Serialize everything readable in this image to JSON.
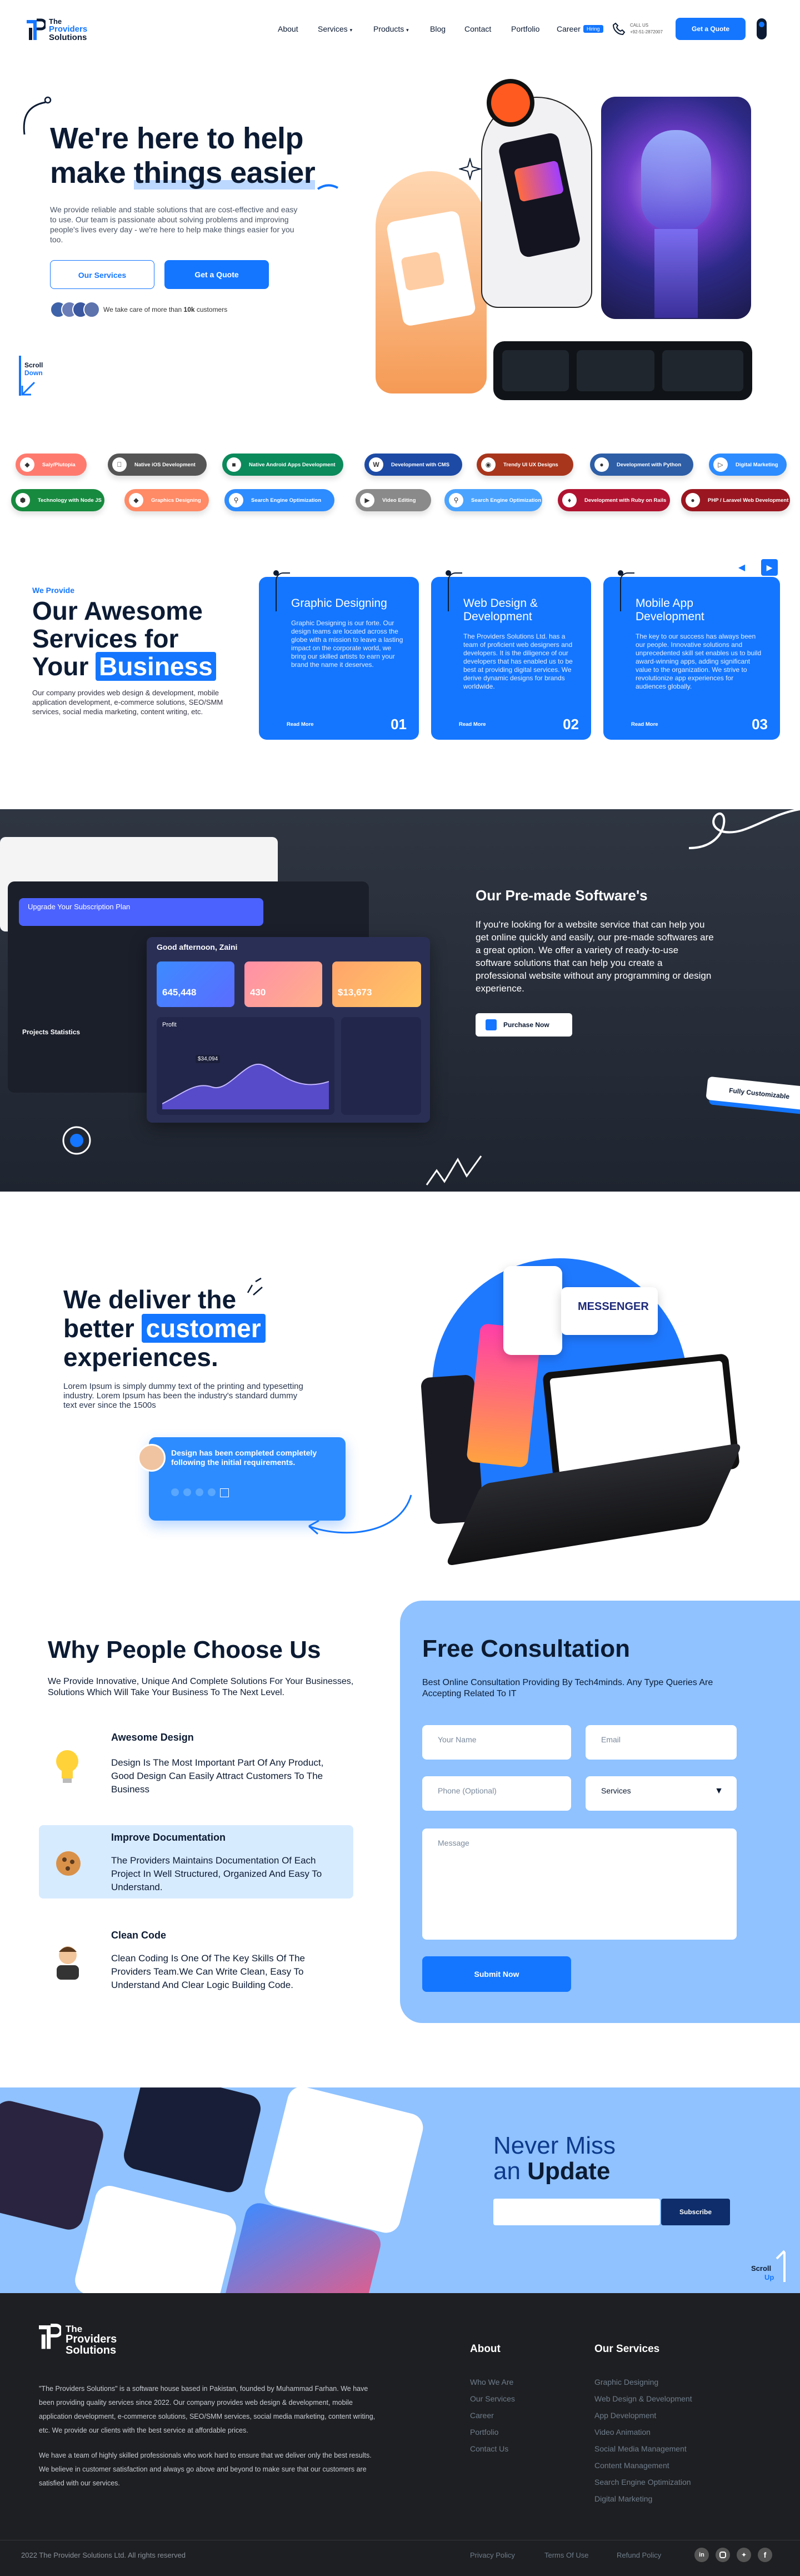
{
  "brand": {
    "line1": "The",
    "line2": "Providers",
    "line3": "Solutions"
  },
  "nav": {
    "items": [
      "About",
      "Services",
      "Products",
      "Blog",
      "Contact",
      "Portfolio",
      "Career"
    ],
    "career_badge": "Hiring",
    "phone_label": "CALL US",
    "phone_number": "+92-51-2872007",
    "quote_button": "Get a Quote"
  },
  "hero": {
    "title_line1": "We're here to help",
    "title_line2_a": "make ",
    "title_line2_b": "things easier",
    "description": "We provide reliable and stable solutions that are cost-effective and easy to use. Our team is passionate about solving problems and improving people's lives every day - we're here to help make things easier for you too.",
    "our_services_button": "Our Services",
    "get_quote_button": "Get a Quote",
    "trust_a": "We take care of more than ",
    "trust_b": "10k",
    "trust_c": " customers",
    "scroll_label_1": "Scroll",
    "scroll_label_2": "Down"
  },
  "chips_row1": [
    "Saly/Plutopia",
    "Native iOS Development",
    "Native Android Apps Development",
    "Development with CMS",
    "Trendy UI UX Designs",
    "Development with Python",
    "Digital Marketing"
  ],
  "chips_row2": [
    "Technology with Node JS",
    "Graphics Designing",
    "Search Engine Optimization",
    "Video Editing",
    "Search Engine Optimization",
    "Development with Ruby on Rails",
    "PHP / Laravel Web Development"
  ],
  "services": {
    "eyebrow": "We Provide",
    "title_1": "Our Awesome",
    "title_2": "Services for",
    "title_3a": "Your ",
    "title_3b": "Business",
    "description": "Our company provides web design & development, mobile application development, e-commerce solutions, SEO/SMM services, social media marketing, content writing, etc.",
    "cards": [
      {
        "title": "Graphic Designing",
        "text": "Graphic Designing is our forte. Our design teams are located across the globe with a mission to leave a lasting impact on the corporate world, we bring our skilled artists to earn your brand the name it deserves.",
        "read_more": "Read More",
        "num": "01"
      },
      {
        "title": "Web Design & Development",
        "text": "The Providers Solutions Ltd. has a team of proficient web designers and developers. It is the diligence of our developers that has enabled us to be best at providing digital services. We derive dynamic designs for brands worldwide.",
        "read_more": "Read More",
        "num": "02"
      },
      {
        "title": "Mobile App Development",
        "text": "The key to our success has always been our people. Innovative solutions and unprecedented skill set enables us to build award-winning apps, adding significant value to the organization. We strive to revolutionize app experiences for audiences globally.",
        "read_more": "Read More",
        "num": "03"
      }
    ]
  },
  "premade": {
    "title": "Our Pre-made Software's",
    "description": "If you're looking for a website service that can help you get online quickly and easily, our pre-made softwares are a great option. We offer a variety of ready-to-use software solutions that can help you create a professional website without any programming or design experience.",
    "button": "Purchase Now",
    "badge": "Fully Customizable",
    "dash": {
      "upgrade": "Upgrade Your Subscription Plan",
      "greeting": "Good afternoon, Zaini",
      "stat1": "645,448",
      "stat2": "430",
      "stat3": "$13,673",
      "profit": "Profit",
      "profit_value": "$34,094",
      "projects": "Projects Statistics"
    }
  },
  "deliver": {
    "title_1": "We deliver the",
    "title_2a": "better ",
    "title_2b": "customer",
    "title_3": "experiences.",
    "description": "Lorem Ipsum is simply dummy text of the printing and typesetting industry. Lorem Ipsum has been the industry's standard dummy text ever since the 1500s",
    "notice": "Design has been completed completely following the initial requirements.",
    "messenger": "MESSENGER"
  },
  "why": {
    "title": "Why People Choose Us",
    "subtitle": "We Provide Innovative, Unique And Complete Solutions For Your Businesses, Solutions Which Will Take Your Business To The Next Level.",
    "features": [
      {
        "title": "Awesome Design",
        "text": "Design Is The Most Important Part Of Any Product, Good Design Can Easily Attract Customers To The Business",
        "icon": "bulb-icon"
      },
      {
        "title": "Improve Documentation",
        "text": "The Providers Maintains Documentation Of Each Project In Well Structured, Organized And Easy To Understand.",
        "icon": "cookie-icon"
      },
      {
        "title": "Clean Code",
        "text": "Clean Coding Is One Of The Key Skills Of The Providers Team.We Can Write Clean, Easy To Understand And Clear Logic Building Code.",
        "icon": "developer-icon"
      }
    ]
  },
  "consult": {
    "title": "Free Consultation",
    "subtitle": "Best Online Consultation Providing By Tech4minds. Any Type Queries Are Accepting Related To IT",
    "name_ph": "Your Name",
    "email_ph": "Email",
    "phone_ph": "Phone (Optional)",
    "services_ph": "Services",
    "message_ph": "Message",
    "submit": "Submit Now"
  },
  "newsletter": {
    "title_1": "Never Miss",
    "title_2a": "an ",
    "title_2b": "Update",
    "button": "Subscribe",
    "scroll_1": "Scroll",
    "scroll_2": "Up"
  },
  "footer": {
    "about_1": "\"The Providers Solutions\" is a software house based in Pakistan, founded by Muhammad Farhan. We have been providing quality services since 2022. Our company provides web design & development, mobile application development, e-commerce solutions, SEO/SMM services, social media marketing, content writing, etc. We provide our clients with the best service at affordable prices.",
    "about_2": "We have a team of highly skilled professionals who work hard to ensure that we deliver only the best results. We believe in customer satisfaction and always go above and beyond to make sure that our customers are satisfied with our services.",
    "about_heading": "About",
    "about_links": [
      "Who We Are",
      "Our Services",
      "Career",
      "Portfolio",
      "Contact Us"
    ],
    "services_heading": "Our Services",
    "service_links": [
      "Graphic Designing",
      "Web Design & Development",
      "App Development",
      "Video Animation",
      "Social Media Management",
      "Content Management",
      "Search Engine Optimization",
      "Digital Marketing"
    ],
    "copyright": "2022 The Provider Solutions Ltd. All rights reserved",
    "legal": [
      "Privacy Policy",
      "Terms Of Use",
      "Refund Policy"
    ],
    "social_icons": [
      "linkedin-icon",
      "instagram-icon",
      "twitter-icon",
      "facebook-icon"
    ]
  },
  "colors": {
    "primary": "#1476ff",
    "dark": "#0c1b33",
    "light_blue": "#8fc2ff",
    "premade_bg": "#283040",
    "footer_bg": "#1e1f22"
  }
}
